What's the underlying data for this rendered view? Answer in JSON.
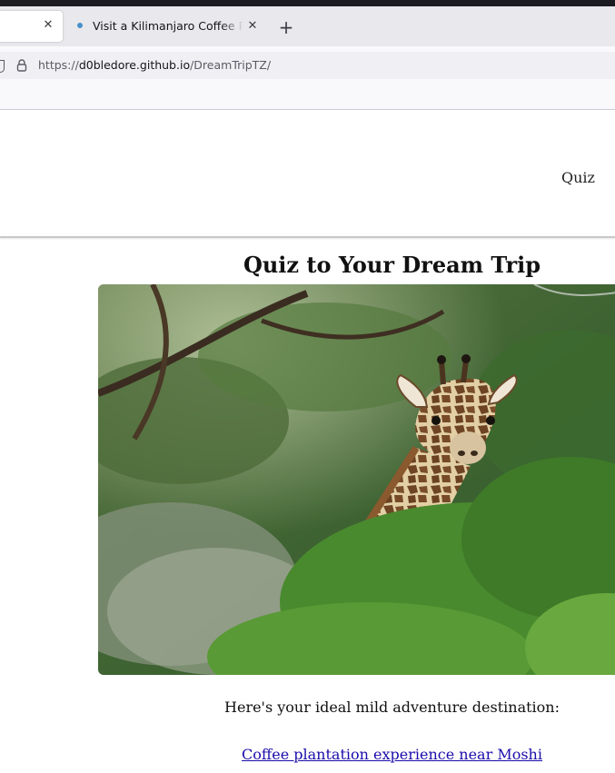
{
  "browser": {
    "tabs": [
      {
        "title": "",
        "active": true
      },
      {
        "title": "Visit a Kilimanjaro Coffee Plantation",
        "active": false
      }
    ],
    "url": {
      "scheme": "https://",
      "host": "d0bledore.github.io",
      "path": "/DreamTripTZ/"
    }
  },
  "site": {
    "nav": {
      "quiz_label": "Quiz"
    }
  },
  "main": {
    "title": "Quiz to Your Dream Trip",
    "result_text": "Here's your ideal mild adventure destination:",
    "result_link": "Coffee plantation experience near Moshi"
  },
  "colors": {
    "link": "#1a0dab",
    "chrome_dark": "#1c1b22",
    "tabstrip": "#e9e9ed"
  },
  "icons": {
    "tab_close": "close-icon",
    "new_tab": "plus-icon",
    "lock": "lock-icon",
    "tracking": "shield-icon"
  }
}
